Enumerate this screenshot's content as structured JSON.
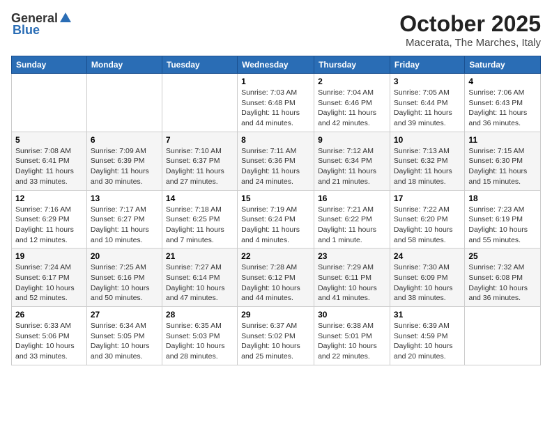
{
  "header": {
    "logo_general": "General",
    "logo_blue": "Blue",
    "title": "October 2025",
    "subtitle": "Macerata, The Marches, Italy"
  },
  "weekdays": [
    "Sunday",
    "Monday",
    "Tuesday",
    "Wednesday",
    "Thursday",
    "Friday",
    "Saturday"
  ],
  "weeks": [
    [
      {
        "day": "",
        "info": ""
      },
      {
        "day": "",
        "info": ""
      },
      {
        "day": "",
        "info": ""
      },
      {
        "day": "1",
        "info": "Sunrise: 7:03 AM\nSunset: 6:48 PM\nDaylight: 11 hours and 44 minutes."
      },
      {
        "day": "2",
        "info": "Sunrise: 7:04 AM\nSunset: 6:46 PM\nDaylight: 11 hours and 42 minutes."
      },
      {
        "day": "3",
        "info": "Sunrise: 7:05 AM\nSunset: 6:44 PM\nDaylight: 11 hours and 39 minutes."
      },
      {
        "day": "4",
        "info": "Sunrise: 7:06 AM\nSunset: 6:43 PM\nDaylight: 11 hours and 36 minutes."
      }
    ],
    [
      {
        "day": "5",
        "info": "Sunrise: 7:08 AM\nSunset: 6:41 PM\nDaylight: 11 hours and 33 minutes."
      },
      {
        "day": "6",
        "info": "Sunrise: 7:09 AM\nSunset: 6:39 PM\nDaylight: 11 hours and 30 minutes."
      },
      {
        "day": "7",
        "info": "Sunrise: 7:10 AM\nSunset: 6:37 PM\nDaylight: 11 hours and 27 minutes."
      },
      {
        "day": "8",
        "info": "Sunrise: 7:11 AM\nSunset: 6:36 PM\nDaylight: 11 hours and 24 minutes."
      },
      {
        "day": "9",
        "info": "Sunrise: 7:12 AM\nSunset: 6:34 PM\nDaylight: 11 hours and 21 minutes."
      },
      {
        "day": "10",
        "info": "Sunrise: 7:13 AM\nSunset: 6:32 PM\nDaylight: 11 hours and 18 minutes."
      },
      {
        "day": "11",
        "info": "Sunrise: 7:15 AM\nSunset: 6:30 PM\nDaylight: 11 hours and 15 minutes."
      }
    ],
    [
      {
        "day": "12",
        "info": "Sunrise: 7:16 AM\nSunset: 6:29 PM\nDaylight: 11 hours and 12 minutes."
      },
      {
        "day": "13",
        "info": "Sunrise: 7:17 AM\nSunset: 6:27 PM\nDaylight: 11 hours and 10 minutes."
      },
      {
        "day": "14",
        "info": "Sunrise: 7:18 AM\nSunset: 6:25 PM\nDaylight: 11 hours and 7 minutes."
      },
      {
        "day": "15",
        "info": "Sunrise: 7:19 AM\nSunset: 6:24 PM\nDaylight: 11 hours and 4 minutes."
      },
      {
        "day": "16",
        "info": "Sunrise: 7:21 AM\nSunset: 6:22 PM\nDaylight: 11 hours and 1 minute."
      },
      {
        "day": "17",
        "info": "Sunrise: 7:22 AM\nSunset: 6:20 PM\nDaylight: 10 hours and 58 minutes."
      },
      {
        "day": "18",
        "info": "Sunrise: 7:23 AM\nSunset: 6:19 PM\nDaylight: 10 hours and 55 minutes."
      }
    ],
    [
      {
        "day": "19",
        "info": "Sunrise: 7:24 AM\nSunset: 6:17 PM\nDaylight: 10 hours and 52 minutes."
      },
      {
        "day": "20",
        "info": "Sunrise: 7:25 AM\nSunset: 6:16 PM\nDaylight: 10 hours and 50 minutes."
      },
      {
        "day": "21",
        "info": "Sunrise: 7:27 AM\nSunset: 6:14 PM\nDaylight: 10 hours and 47 minutes."
      },
      {
        "day": "22",
        "info": "Sunrise: 7:28 AM\nSunset: 6:12 PM\nDaylight: 10 hours and 44 minutes."
      },
      {
        "day": "23",
        "info": "Sunrise: 7:29 AM\nSunset: 6:11 PM\nDaylight: 10 hours and 41 minutes."
      },
      {
        "day": "24",
        "info": "Sunrise: 7:30 AM\nSunset: 6:09 PM\nDaylight: 10 hours and 38 minutes."
      },
      {
        "day": "25",
        "info": "Sunrise: 7:32 AM\nSunset: 6:08 PM\nDaylight: 10 hours and 36 minutes."
      }
    ],
    [
      {
        "day": "26",
        "info": "Sunrise: 6:33 AM\nSunset: 5:06 PM\nDaylight: 10 hours and 33 minutes."
      },
      {
        "day": "27",
        "info": "Sunrise: 6:34 AM\nSunset: 5:05 PM\nDaylight: 10 hours and 30 minutes."
      },
      {
        "day": "28",
        "info": "Sunrise: 6:35 AM\nSunset: 5:03 PM\nDaylight: 10 hours and 28 minutes."
      },
      {
        "day": "29",
        "info": "Sunrise: 6:37 AM\nSunset: 5:02 PM\nDaylight: 10 hours and 25 minutes."
      },
      {
        "day": "30",
        "info": "Sunrise: 6:38 AM\nSunset: 5:01 PM\nDaylight: 10 hours and 22 minutes."
      },
      {
        "day": "31",
        "info": "Sunrise: 6:39 AM\nSunset: 4:59 PM\nDaylight: 10 hours and 20 minutes."
      },
      {
        "day": "",
        "info": ""
      }
    ]
  ]
}
